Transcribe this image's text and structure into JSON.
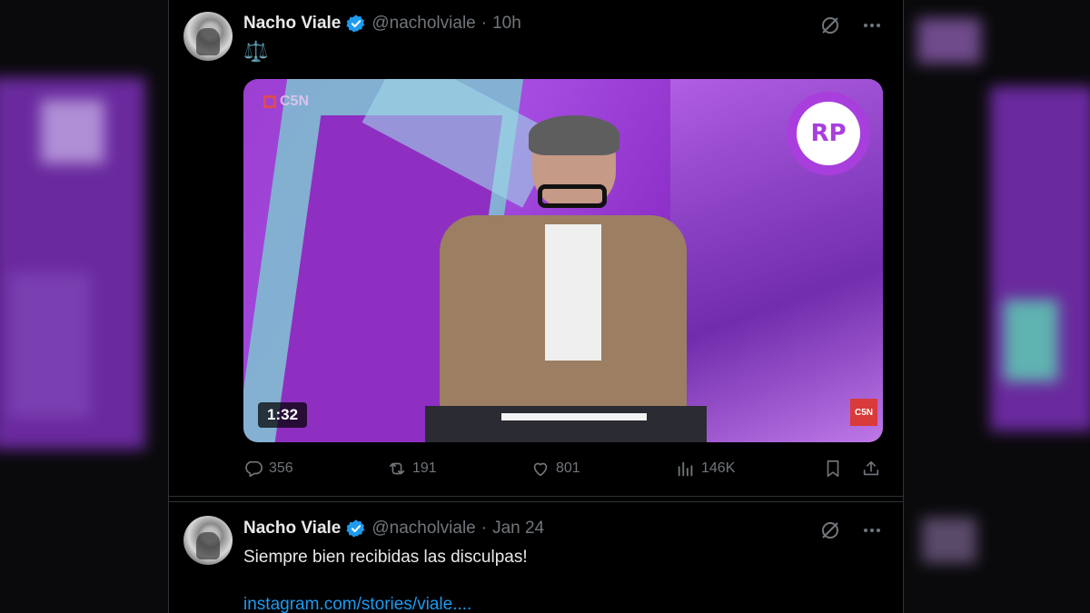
{
  "tweets": [
    {
      "author_name": "Nacho Viale",
      "handle": "@nacholviale",
      "separator": "·",
      "time": "10h",
      "emoji": "⚖️",
      "video": {
        "duration": "1:32",
        "logo_text": "RP",
        "channel": "C5N",
        "channel_corner": "C5N"
      },
      "stats": {
        "replies": "356",
        "reposts": "191",
        "likes": "801",
        "views": "146K"
      }
    },
    {
      "author_name": "Nacho Viale",
      "handle": "@nacholviale",
      "separator": "·",
      "time": "Jan 24",
      "text": "Siempre bien recibidas las disculpas!",
      "link": "instagram.com/stories/viale...."
    }
  ],
  "colors": {
    "background": "#000000",
    "text": "#e7e9ea",
    "muted": "#71767b",
    "accent": "#1d9bf0",
    "video_purple": "#a54ce0"
  },
  "icons": [
    "verified-badge-icon",
    "grok-icon",
    "more-icon",
    "reply-icon",
    "repost-icon",
    "like-icon",
    "views-icon",
    "bookmark-icon",
    "share-icon"
  ]
}
